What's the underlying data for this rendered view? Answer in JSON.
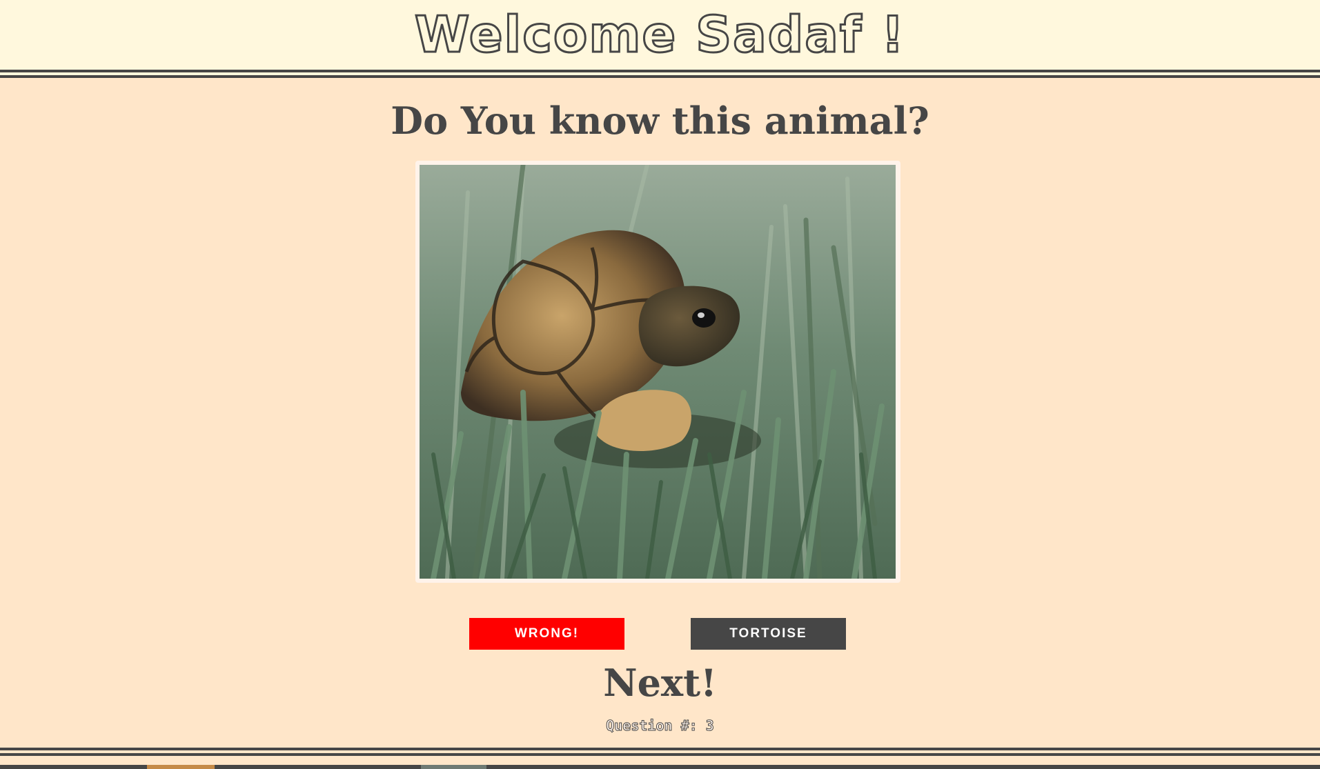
{
  "header": {
    "title": "Welcome Sadaf !"
  },
  "quiz": {
    "question": "Do You know this animal?",
    "image_subject": "tortoise in grass",
    "choices": [
      {
        "label": "WRONG!",
        "state": "wrong",
        "color": "#ff0000"
      },
      {
        "label": "TORTOISE",
        "state": "neutral",
        "color": "#464646"
      }
    ],
    "next_label": "Next!",
    "counter_label": "Question #: 3"
  },
  "colors": {
    "header_bg": "#fff8dd",
    "page_bg": "#ffe6c9",
    "ink": "#464646",
    "wrong": "#ff0000"
  }
}
